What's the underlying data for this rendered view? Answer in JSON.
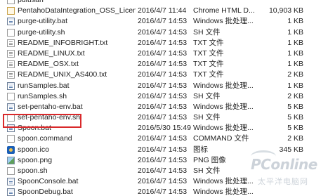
{
  "files": [
    {
      "name": "pdiusan",
      "date": "",
      "type": "",
      "size": "",
      "icon": "generic-file-icon",
      "icon_class": "generic"
    },
    {
      "name": "PentahoDataIntegration_OSS_License...",
      "date": "2016/4/7 11:44",
      "type": "Chrome HTML D...",
      "size": "10,903 KB",
      "icon": "chrome-html-icon",
      "icon_class": "html"
    },
    {
      "name": "purge-utility.bat",
      "date": "2016/4/7 14:53",
      "type": "Windows 批处理...",
      "size": "1 KB",
      "icon": "batch-file-icon",
      "icon_class": "bat"
    },
    {
      "name": "purge-utility.sh",
      "date": "2016/4/7 14:53",
      "type": "SH 文件",
      "size": "1 KB",
      "icon": "shell-script-icon",
      "icon_class": "sh"
    },
    {
      "name": "README_INFOBRIGHT.txt",
      "date": "2016/4/7 14:53",
      "type": "TXT 文件",
      "size": "1 KB",
      "icon": "text-file-icon",
      "icon_class": "txt"
    },
    {
      "name": "README_LINUX.txt",
      "date": "2016/4/7 14:53",
      "type": "TXT 文件",
      "size": "1 KB",
      "icon": "text-file-icon",
      "icon_class": "txt"
    },
    {
      "name": "README_OSX.txt",
      "date": "2016/4/7 14:53",
      "type": "TXT 文件",
      "size": "1 KB",
      "icon": "text-file-icon",
      "icon_class": "txt"
    },
    {
      "name": "README_UNIX_AS400.txt",
      "date": "2016/4/7 14:53",
      "type": "TXT 文件",
      "size": "2 KB",
      "icon": "text-file-icon",
      "icon_class": "txt"
    },
    {
      "name": "runSamples.bat",
      "date": "2016/4/7 14:53",
      "type": "Windows 批处理...",
      "size": "1 KB",
      "icon": "batch-file-icon",
      "icon_class": "bat"
    },
    {
      "name": "runSamples.sh",
      "date": "2016/4/7 14:53",
      "type": "SH 文件",
      "size": "2 KB",
      "icon": "shell-script-icon",
      "icon_class": "sh"
    },
    {
      "name": "set-pentaho-env.bat",
      "date": "2016/4/7 14:53",
      "type": "Windows 批处理...",
      "size": "5 KB",
      "icon": "batch-file-icon",
      "icon_class": "bat"
    },
    {
      "name": "set-pentaho-env.sh",
      "date": "2016/4/7 14:53",
      "type": "SH 文件",
      "size": "5 KB",
      "icon": "shell-script-icon",
      "icon_class": "sh"
    },
    {
      "name": "Spoon.bat",
      "date": "2016/5/30 15:49",
      "type": "Windows 批处理...",
      "size": "5 KB",
      "icon": "batch-file-icon",
      "icon_class": "bat"
    },
    {
      "name": "spoon.command",
      "date": "2016/4/7 14:53",
      "type": "COMMAND 文件",
      "size": "2 KB",
      "icon": "command-file-icon",
      "icon_class": "generic"
    },
    {
      "name": "spoon.ico",
      "date": "2016/4/7 14:53",
      "type": "图标",
      "size": "345 KB",
      "icon": "spoon-ico-icon",
      "icon_class": "ico"
    },
    {
      "name": "spoon.png",
      "date": "2016/4/7 14:53",
      "type": "PNG 图像",
      "size": "",
      "icon": "png-image-icon",
      "icon_class": "png"
    },
    {
      "name": "spoon.sh",
      "date": "2016/4/7 14:53",
      "type": "SH 文件",
      "size": "",
      "icon": "shell-script-icon",
      "icon_class": "sh"
    },
    {
      "name": "SpoonConsole.bat",
      "date": "2016/4/7 14:53",
      "type": "Windows 批处理...",
      "size": "",
      "icon": "batch-file-icon",
      "icon_class": "bat"
    },
    {
      "name": "SpoonDebug.bat",
      "date": "2016/4/7 14:53",
      "type": "Windows 批处理...",
      "size": "",
      "icon": "batch-file-icon",
      "icon_class": "bat"
    }
  ],
  "highlight": {
    "file": "Spoon.bat",
    "color": "#d9292b"
  },
  "watermark": {
    "brand": "PConline",
    "tagline": "太平洋电脑网"
  }
}
